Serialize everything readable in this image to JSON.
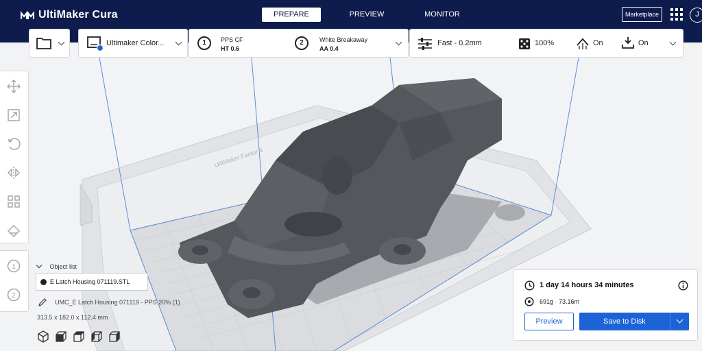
{
  "app": {
    "title": "UltiMaker Cura"
  },
  "stages": [
    {
      "label": "PREPARE",
      "active": true
    },
    {
      "label": "PREVIEW",
      "active": false
    },
    {
      "label": "MONITOR",
      "active": false
    }
  ],
  "header": {
    "marketplace_label": "Marketplace",
    "account_initial": "J"
  },
  "printer": {
    "name": "Ultimaker Color..."
  },
  "extruders": [
    {
      "number": "1",
      "material": "PPS CF",
      "core": "HT 0.6"
    },
    {
      "number": "2",
      "material": "White Breakaway",
      "core": "AA 0.4"
    }
  ],
  "settings": {
    "profile": "Fast - 0.2mm",
    "infill": "100%",
    "support": "On",
    "adhesion": "On"
  },
  "viewport": {
    "build_plate_label": "UltiMaker Factor 4"
  },
  "object_list": {
    "header": "Object list",
    "items": [
      "E Latch Housing 071119.STL"
    ],
    "job_name": "UMC_E Latch Housing 071119 - PPS 20% (1)",
    "dimensions": "313.5 x 182.0 x 112.4 mm"
  },
  "print_panel": {
    "time": "1 day 14 hours 34 minutes",
    "material": "691g · 73.16m",
    "preview_label": "Preview",
    "save_label": "Save to Disk"
  },
  "colors": {
    "header_bg": "#0e1c4d",
    "accent": "#1d63d8",
    "model": "#55585d"
  }
}
